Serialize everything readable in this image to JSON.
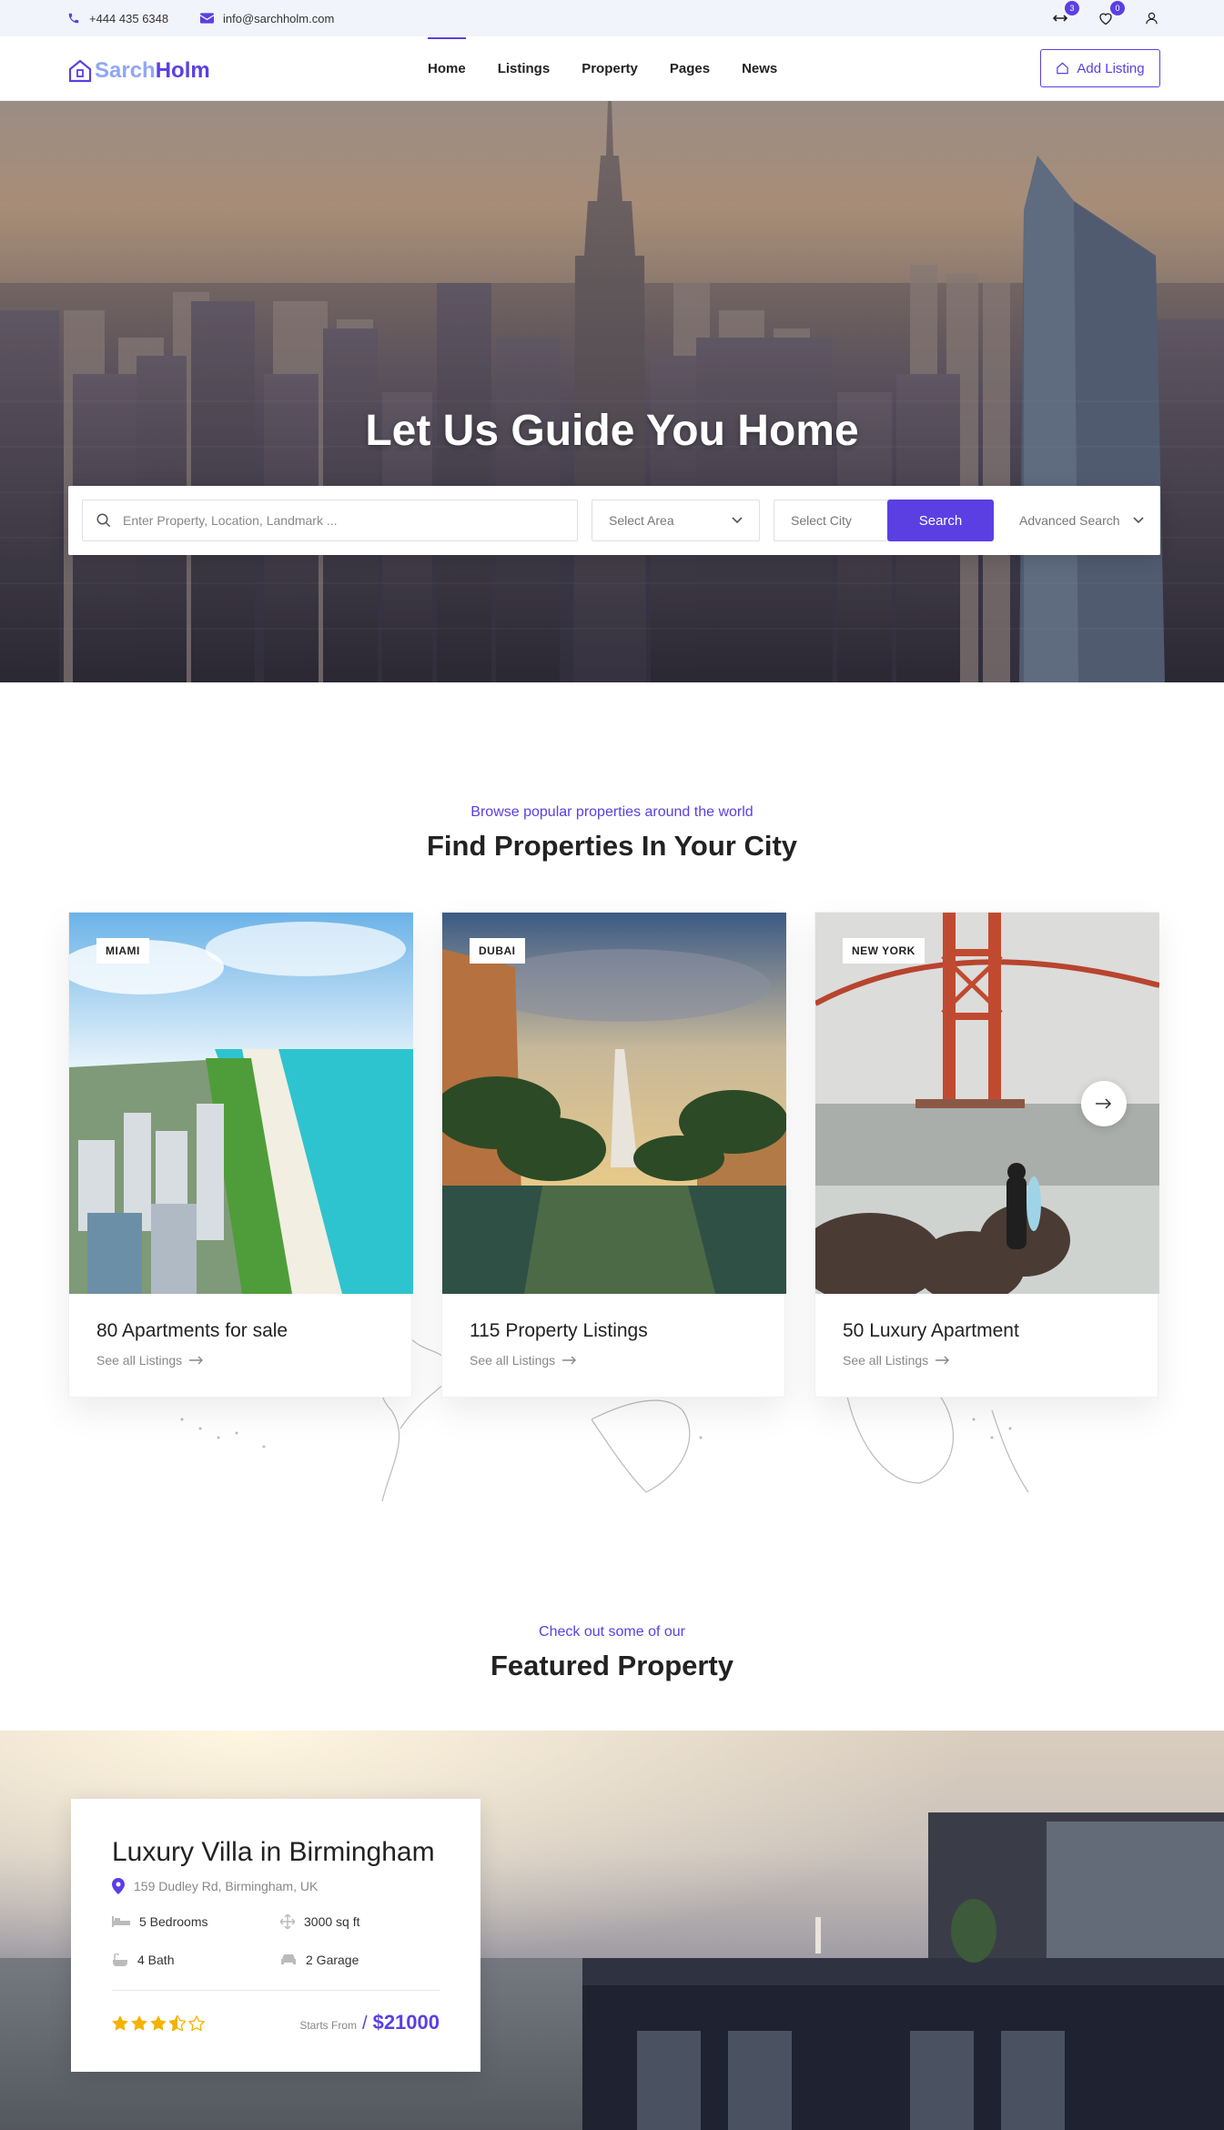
{
  "topbar": {
    "phone": "+444 435 6348",
    "email": "info@sarchholm.com",
    "compare_count": "3",
    "wishlist_count": "0"
  },
  "nav": {
    "logo_part1": "Sarch",
    "logo_part2": "Holm",
    "items": [
      "Home",
      "Listings",
      "Property",
      "Pages",
      "News"
    ],
    "add_listing": "Add Listing"
  },
  "hero": {
    "title": "Let Us Guide You Home",
    "search_placeholder": "Enter Property, Location, Landmark ...",
    "select_area": "Select Area",
    "select_city": "Select City",
    "search_button": "Search",
    "advanced_search": "Advanced Search"
  },
  "cities": {
    "subtitle": "Browse popular properties around the world",
    "title": "Find Properties In Your City",
    "cards": [
      {
        "tag": "MIAMI",
        "title": "80 Apartments for sale",
        "link": "See all Listings"
      },
      {
        "tag": "DUBAI",
        "title": "115 Property Listings",
        "link": "See all Listings"
      },
      {
        "tag": "NEW YORK",
        "title": "50 Luxury Apartment",
        "link": "See all Listings"
      }
    ]
  },
  "featured": {
    "subtitle": "Check out some of our",
    "title": "Featured Property",
    "card": {
      "title": "Luxury Villa in Birmingham",
      "address": "159 Dudley Rd, Birmingham, UK",
      "bedrooms": "5 Bedrooms",
      "area": "3000 sq ft",
      "bath": "4 Bath",
      "garage": "2 Garage",
      "rating": 3.5,
      "price_label": "Starts From",
      "price": "$21000"
    }
  },
  "colors": {
    "accent": "#5b3fe3",
    "logo_light": "#8fa7f5",
    "star": "#f5b301"
  }
}
